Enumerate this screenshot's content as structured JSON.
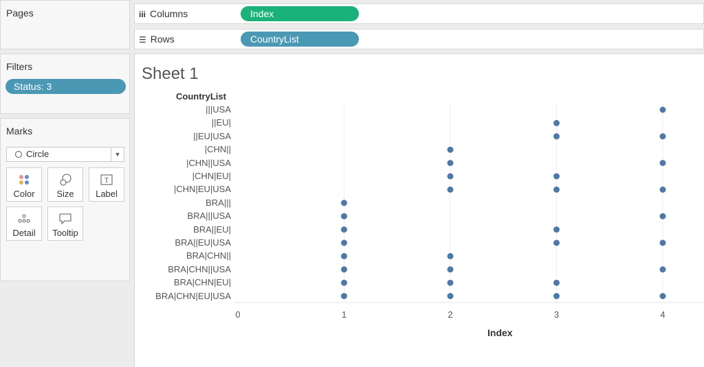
{
  "pages_panel": {
    "title": "Pages"
  },
  "columns_shelf": {
    "label": "Columns",
    "icon": "columns-icon",
    "pill": "Index",
    "pill_color": "#1ab27a"
  },
  "rows_shelf": {
    "label": "Rows",
    "icon": "rows-icon",
    "pill": "CountryList",
    "pill_color": "#4a98b4"
  },
  "filters_panel": {
    "title": "Filters",
    "pill": "Status: 3"
  },
  "marks_panel": {
    "title": "Marks",
    "mark_type": "Circle",
    "buttons": [
      "Color",
      "Size",
      "Label",
      "Detail",
      "Tooltip"
    ]
  },
  "sheet": {
    "title": "Sheet 1"
  },
  "chart_data": {
    "type": "scatter",
    "row_header": "CountryList",
    "xlabel": "Index",
    "xlim": [
      0,
      4
    ],
    "x_ticks": [
      "0",
      "1",
      "2",
      "3",
      "4"
    ],
    "mark_color": "#4e79a7",
    "categories": [
      "|||USA",
      "||EU|",
      "||EU|USA",
      "|CHN||",
      "|CHN||USA",
      "|CHN|EU|",
      "|CHN|EU|USA",
      "BRA|||",
      "BRA|||USA",
      "BRA||EU|",
      "BRA||EU|USA",
      "BRA|CHN||",
      "BRA|CHN||USA",
      "BRA|CHN|EU|",
      "BRA|CHN|EU|USA"
    ],
    "points": [
      [
        4
      ],
      [
        3
      ],
      [
        3,
        4
      ],
      [
        2
      ],
      [
        2,
        4
      ],
      [
        2,
        3
      ],
      [
        2,
        3,
        4
      ],
      [
        1
      ],
      [
        1,
        4
      ],
      [
        1,
        3
      ],
      [
        1,
        3,
        4
      ],
      [
        1,
        2
      ],
      [
        1,
        2,
        4
      ],
      [
        1,
        2,
        3
      ],
      [
        1,
        2,
        3,
        4
      ]
    ]
  }
}
